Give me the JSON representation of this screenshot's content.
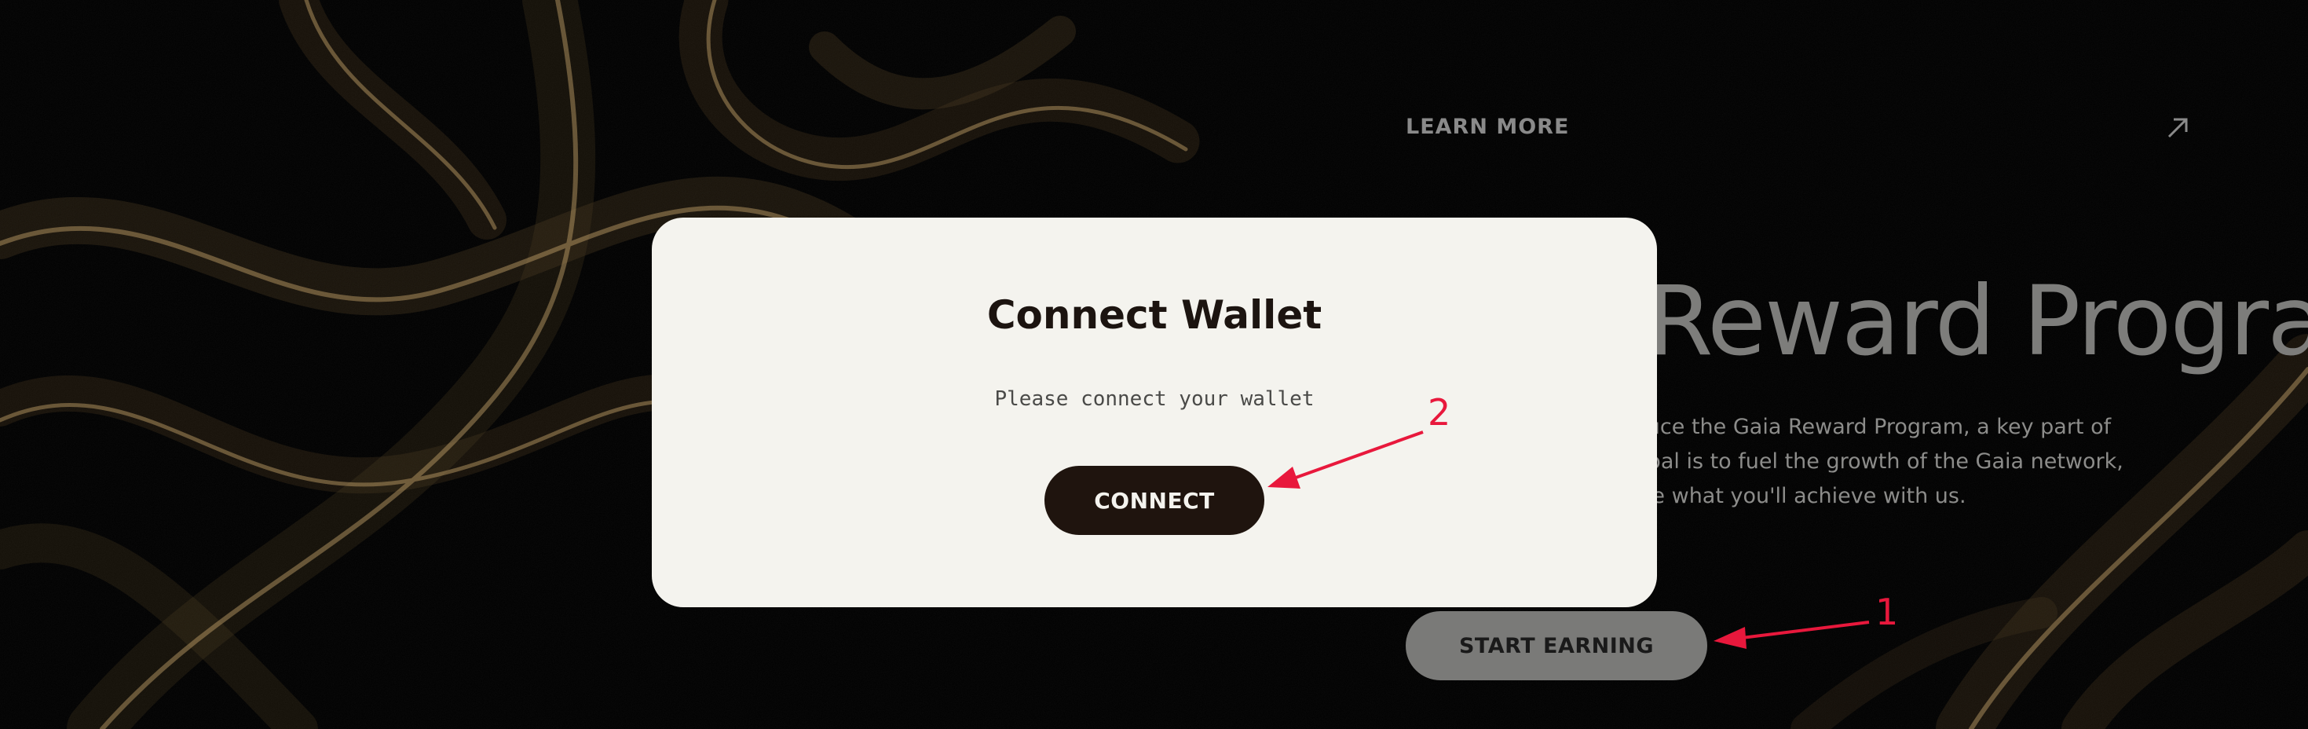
{
  "hero": {
    "learn_more": "LEARN MORE",
    "title": "Gaia Reward Program",
    "description": "We're excited to introduce the Gaia Reward Program, a key part of our reward plan! Our goal is to fuel the growth of the Gaia network, and we can't wait to see what you'll achieve with us.",
    "start_button": "START EARNING"
  },
  "modal": {
    "title": "Connect Wallet",
    "subtitle": "Please connect your wallet",
    "connect_button": "CONNECT"
  },
  "annotations": {
    "label_1": "1",
    "label_2": "2"
  },
  "colors": {
    "background": "#000000",
    "particles": "#b8935a",
    "modal_bg": "#f4f3ee",
    "connect_button": "#1f140e",
    "annotation": "#e8183c"
  }
}
